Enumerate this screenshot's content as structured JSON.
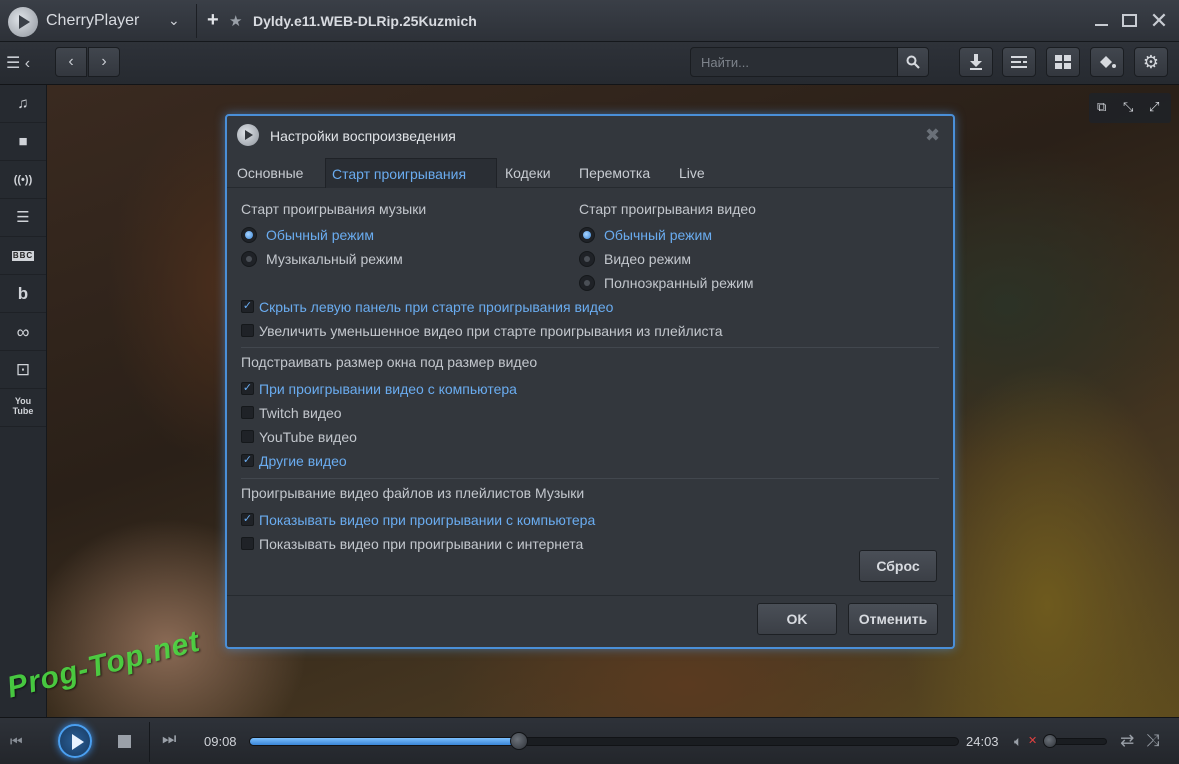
{
  "titlebar": {
    "app_name": "CherryPlayer",
    "dropdown_glyph": "⌄",
    "window_title": "Dyldy.e11.WEB-DLRip.25Kuzmich"
  },
  "toolbar": {
    "search": {
      "placeholder": "Найти..."
    }
  },
  "sidebar": {
    "items": [
      {
        "icon": "music-icon",
        "glyph": "♫"
      },
      {
        "icon": "video-camera-icon",
        "glyph": "■"
      },
      {
        "icon": "radio-broadcast-icon",
        "glyph": "((•))"
      },
      {
        "icon": "tv-list-icon",
        "glyph": "☰"
      },
      {
        "icon": "bbc-icon",
        "text": "BBC"
      },
      {
        "icon": "bandcamp-icon",
        "glyph": "b"
      },
      {
        "icon": "lastfm-icon",
        "glyph": "∞"
      },
      {
        "icon": "twitch-icon",
        "glyph": "⊡"
      },
      {
        "icon": "youtube-icon",
        "text": "You Tube"
      }
    ]
  },
  "dialog": {
    "title": "Настройки воспроизведения",
    "tabs": [
      {
        "label": "Основные",
        "active": false
      },
      {
        "label": "Старт проигрывания",
        "active": true
      },
      {
        "label": "Кодеки",
        "active": false
      },
      {
        "label": "Перемотка",
        "active": false
      },
      {
        "label": "Live",
        "active": false
      }
    ],
    "music_start": {
      "heading": "Старт проигрывания музыки",
      "options": [
        {
          "label": "Обычный режим",
          "selected": true
        },
        {
          "label": "Музыкальный режим",
          "selected": false
        }
      ]
    },
    "video_start": {
      "heading": "Старт проигрывания видео",
      "options": [
        {
          "label": "Обычный режим",
          "selected": true
        },
        {
          "label": "Видео режим",
          "selected": false
        },
        {
          "label": "Полноэкранный режим",
          "selected": false
        }
      ]
    },
    "general_checks": [
      {
        "label": "Скрыть левую панель при старте проигрывания видео",
        "checked": true
      },
      {
        "label": "Увеличить уменьшенное видео при старте проигрывания из плейлиста",
        "checked": false
      }
    ],
    "resize": {
      "heading": "Подстраивать размер окна под размер видео",
      "checks": [
        {
          "label": "При проигрывании видео с компьютера",
          "checked": true
        },
        {
          "label": "Twitch видео",
          "checked": false
        },
        {
          "label": "YouTube видео",
          "checked": false
        },
        {
          "label": "Другие видео",
          "checked": true
        }
      ]
    },
    "playlist_video": {
      "heading": "Проигрывание видео файлов из плейлистов Музыки",
      "checks": [
        {
          "label": "Показывать видео при проигрывании с компьютера",
          "checked": true
        },
        {
          "label": "Показывать видео при проигрывании с интернета",
          "checked": false
        }
      ]
    },
    "reset_label": "Сброс",
    "ok_label": "OK",
    "cancel_label": "Отменить"
  },
  "player": {
    "current_time": "09:08",
    "total_time": "24:03",
    "progress_percent": 38,
    "volume_percent": 0,
    "muted": true
  },
  "watermark": "Prog-Top.net",
  "colors": {
    "accent": "#4a8fd8",
    "selected_text": "#6aacf0",
    "mute_indicator": "#e04040",
    "watermark": "#50e646"
  }
}
